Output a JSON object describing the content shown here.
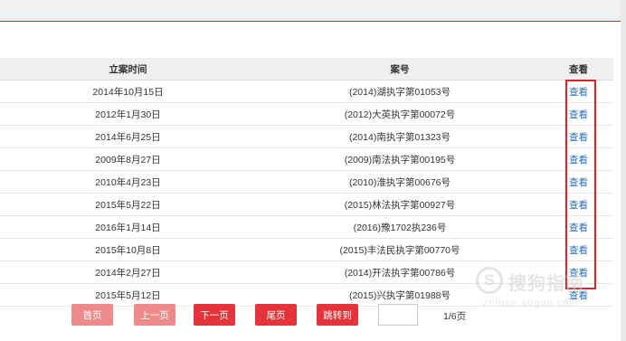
{
  "table": {
    "headers": [
      "立案时间",
      "案号",
      "查看"
    ],
    "rows": [
      {
        "date": "2014年10月15日",
        "case_no": "(2014)湖执字第01053号",
        "link": "查看"
      },
      {
        "date": "2012年1月30日",
        "case_no": "(2012)大英执字第00072号",
        "link": "查看"
      },
      {
        "date": "2014年6月25日",
        "case_no": "(2014)南执字第01323号",
        "link": "查看"
      },
      {
        "date": "2009年8月27日",
        "case_no": "(2009)南法执字第00195号",
        "link": "查看"
      },
      {
        "date": "2010年4月23日",
        "case_no": "(2010)淮执字第00676号",
        "link": "查看"
      },
      {
        "date": "2015年5月22日",
        "case_no": "(2015)林法执字第00927号",
        "link": "查看"
      },
      {
        "date": "2016年1月14日",
        "case_no": "(2016)豫1702执236号",
        "link": "查看"
      },
      {
        "date": "2015年10月8日",
        "case_no": "(2015)丰法民执字第00770号",
        "link": "查看"
      },
      {
        "date": "2014年2月27日",
        "case_no": "(2014)开法执字第00786号",
        "link": "查看"
      },
      {
        "date": "2015年5月12日",
        "case_no": "(2015)兴执字第01988号",
        "link": "查看"
      }
    ]
  },
  "pager": {
    "first": "首页",
    "prev": "上一页",
    "next": "下一页",
    "last": "尾页",
    "jump": "跳转到",
    "input_value": "",
    "page_info": "1/6页"
  },
  "watermark": {
    "logo_char": "S",
    "name": "搜狗指南",
    "url": "zhinan.sogou.com"
  },
  "colors": {
    "accent": "#e4333a",
    "accent_light": "#ee8a8a",
    "link": "#2a6ebb",
    "highlight_border": "#e0232b"
  },
  "icons": {
    "watermark_logo": "sogou-logo-icon"
  }
}
